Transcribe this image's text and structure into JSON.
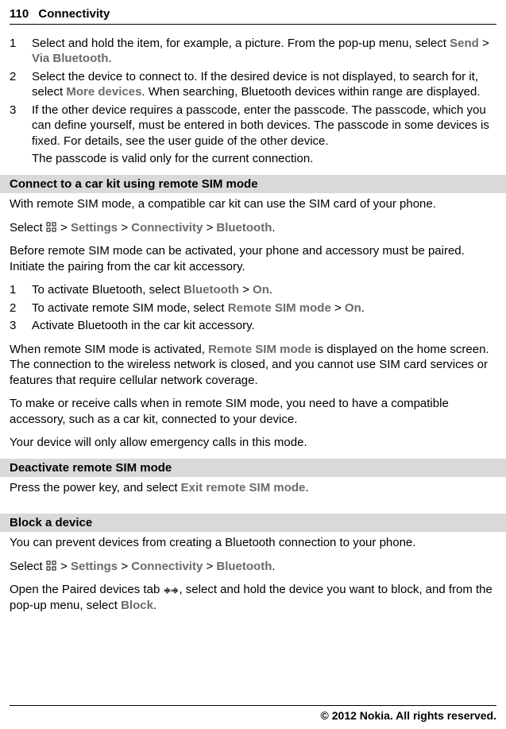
{
  "header": {
    "page_number": "110",
    "section": "Connectivity"
  },
  "steps_top": [
    {
      "num": "1",
      "text_parts": [
        "Select and hold the item, for example, a picture. From the pop-up menu, select ",
        "Send",
        " > ",
        "Via Bluetooth",
        "."
      ]
    },
    {
      "num": "2",
      "text_parts": [
        "Select the device to connect to. If the desired device is not displayed, to search for it, select ",
        "More devices",
        ". When searching, Bluetooth devices within range are displayed."
      ]
    },
    {
      "num": "3",
      "text_parts": [
        "If the other device requires a passcode, enter the passcode. The passcode, which you can define yourself, must be entered in both devices. The passcode in some devices is fixed. For details, see the user guide of the other device."
      ],
      "extra": "The passcode is valid only for the current connection."
    }
  ],
  "section_remote_sim": {
    "title": "Connect to a car kit using remote SIM mode",
    "intro": "With remote SIM mode, a compatible car kit can use the SIM card of your phone.",
    "select_line": {
      "prefix": "Select ",
      "parts": [
        " > ",
        "Settings",
        " > ",
        "Connectivity",
        " > ",
        "Bluetooth",
        "."
      ]
    },
    "before": "Before remote SIM mode can be activated, your phone and accessory must be paired. Initiate the pairing from the car kit accessory.",
    "steps": [
      {
        "num": "1",
        "parts": [
          "To activate Bluetooth, select ",
          "Bluetooth",
          " > ",
          "On",
          "."
        ]
      },
      {
        "num": "2",
        "parts": [
          "To activate remote SIM mode, select ",
          "Remote SIM mode",
          " > ",
          "On",
          "."
        ]
      },
      {
        "num": "3",
        "parts": [
          "Activate Bluetooth in the car kit accessory."
        ]
      }
    ],
    "after1_parts": [
      "When remote SIM mode is activated, ",
      "Remote SIM mode",
      " is displayed on the home screen. The connection to the wireless network is closed, and you cannot use SIM card services or features that require cellular network coverage."
    ],
    "after2": "To make or receive calls when in remote SIM mode, you need to have a compatible accessory, such as a car kit, connected to your device.",
    "after3": "Your device will only allow emergency calls in this mode."
  },
  "section_deactivate": {
    "title": "Deactivate remote SIM mode",
    "text_parts": [
      "Press the power key, and select ",
      "Exit remote SIM mode",
      "."
    ]
  },
  "section_block": {
    "title": "Block a device",
    "intro": "You can prevent devices from creating a Bluetooth connection to your phone.",
    "select_line": {
      "prefix": "Select ",
      "parts": [
        " > ",
        "Settings",
        " > ",
        "Connectivity",
        " > ",
        "Bluetooth",
        "."
      ]
    },
    "tab_parts": [
      "Open the Paired devices tab ",
      ", select and hold the device you want to block, and from the pop-up menu, select ",
      "Block",
      "."
    ]
  },
  "footer": "© 2012 Nokia. All rights reserved."
}
